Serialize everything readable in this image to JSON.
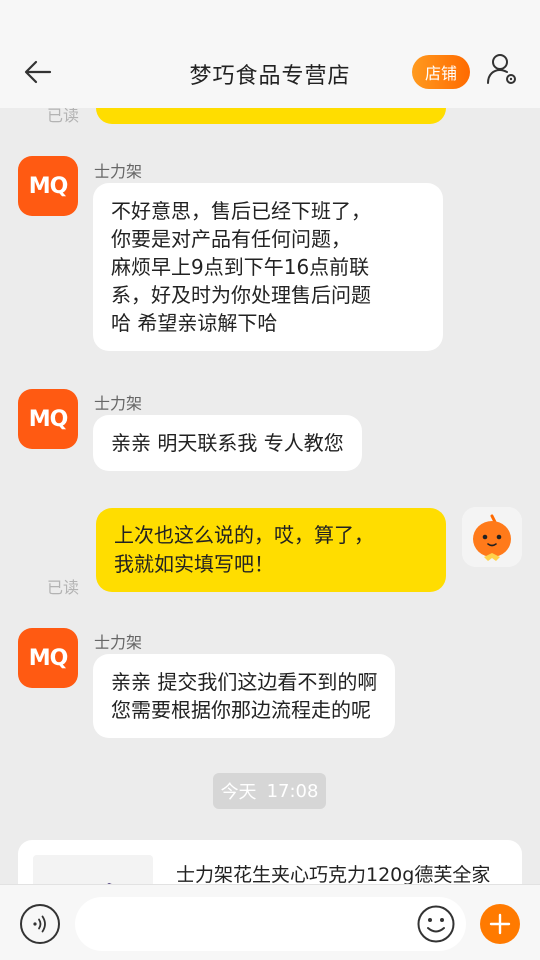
{
  "header": {
    "title": "梦巧食品专营店",
    "shop_label": "店铺"
  },
  "messages": {
    "read_label": "已读",
    "sender": "士力架",
    "avatar_text": "MQ",
    "msg1": [
      "不好意思，售后已经下班了，",
      "你要是对产品有任何问题，",
      "麻烦早上9点到下午16点前联",
      "系，好及时为你处理售后问题",
      "哈 希望亲谅解下哈"
    ],
    "msg2": "亲亲 明天联系我 专人教您",
    "msg3": [
      "上次也这么说的，哎，算了，",
      "我就如实填写吧！"
    ],
    "msg4": [
      "亲亲 提交我们这边看不到的啊",
      "您需要根据你那边流程走的呢"
    ]
  },
  "timestamp": {
    "day": "今天",
    "time": "17:08"
  },
  "product": {
    "title": "士力架花生夹心巧克力120g德芙全家"
  },
  "input": {
    "value": "",
    "placeholder": ""
  },
  "colors": {
    "accent": "#ff6a00",
    "outgoing_bubble": "#ffdd00",
    "incoming_bubble": "#ffffff",
    "brand_avatar": "#ff5a12"
  }
}
